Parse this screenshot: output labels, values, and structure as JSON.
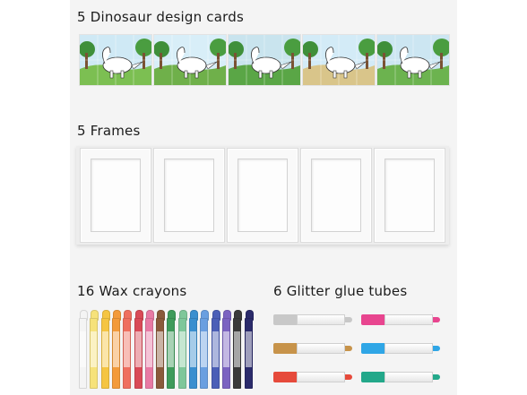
{
  "sections": {
    "cards_title": "5 Dinosaur design cards",
    "frames_title": "5 Frames",
    "crayons_title": "16 Wax crayons",
    "glue_title": "6 Glitter glue tubes"
  },
  "cards": [
    {
      "name": "dinosaur-card-1",
      "sky": "#cfe9f5",
      "ground": "#7cbf52"
    },
    {
      "name": "dinosaur-card-2",
      "sky": "#d8eef8",
      "ground": "#6fb04a"
    },
    {
      "name": "dinosaur-card-3",
      "sky": "#c9e4ee",
      "ground": "#5aa646"
    },
    {
      "name": "dinosaur-card-4",
      "sky": "#d3ebf7",
      "ground": "#d9c58a"
    },
    {
      "name": "dinosaur-card-5",
      "sky": "#cce6f2",
      "ground": "#6cb34f"
    }
  ],
  "frames_count": 5,
  "crayon_colors": [
    "#f4f4f4",
    "#f6e27a",
    "#f5c542",
    "#f39a3a",
    "#ef6f5f",
    "#d94a57",
    "#e87aa4",
    "#8a5a3b",
    "#3f9b5b",
    "#7fc79a",
    "#3a8fcf",
    "#6a9fe0",
    "#4b5fb7",
    "#7b63c1",
    "#3a3a3a",
    "#2b2b6b"
  ],
  "glue_tubes": [
    {
      "color": "#c8c8c8",
      "label": "silver"
    },
    {
      "color": "#e8458f",
      "label": "pink"
    },
    {
      "color": "#c7934a",
      "label": "gold"
    },
    {
      "color": "#2fa6e6",
      "label": "blue"
    },
    {
      "color": "#e64a3b",
      "label": "red"
    },
    {
      "color": "#23a88a",
      "label": "green"
    }
  ]
}
